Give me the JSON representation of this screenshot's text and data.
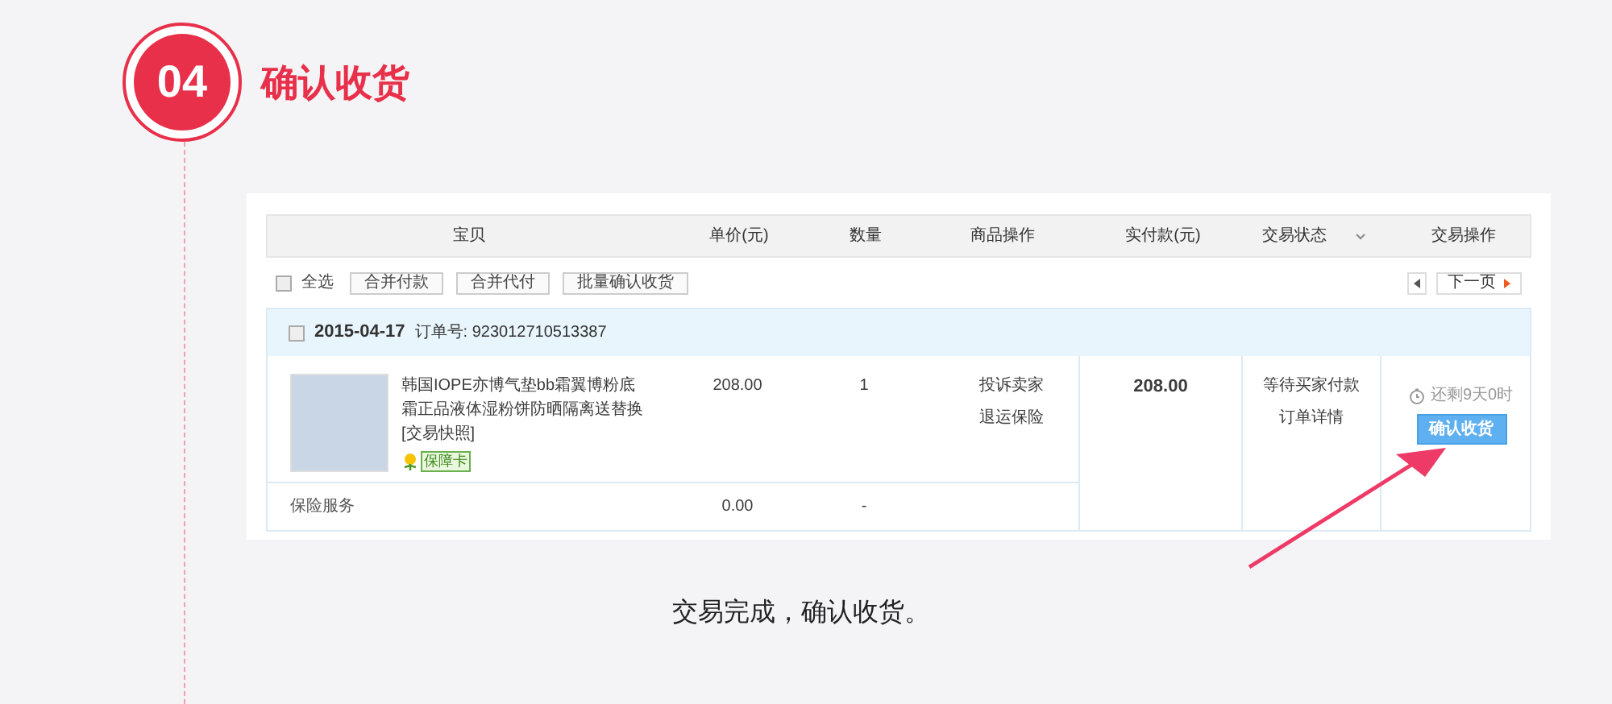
{
  "step": {
    "number": "04",
    "title": "确认收货"
  },
  "table": {
    "columns": [
      "宝贝",
      "单价(元)",
      "数量",
      "商品操作",
      "实付款(元)",
      "交易状态",
      "交易操作"
    ]
  },
  "toolbar": {
    "select_all": {
      "label": "全选",
      "checked": false
    },
    "buttons": [
      "合并付款",
      "合并代付",
      "批量确认收货"
    ],
    "next_page": "下一页"
  },
  "order": {
    "checked": false,
    "date": "2015-04-17",
    "number_label": "订单号:",
    "number": "923012710513387",
    "item": {
      "title": "韩国IOPE亦博气垫bb霜翼博粉底霜正品液体湿粉饼防晒隔离送替换",
      "snapshot": "[交易快照]",
      "badge": "保障卡",
      "price": "208.00",
      "quantity": "1",
      "actions": [
        "投诉卖家",
        "退运保险"
      ]
    },
    "insurance": {
      "label": "保险服务",
      "price": "0.00",
      "quantity": "-"
    },
    "total": "208.00",
    "status_links": [
      "等待买家付款",
      "订单详情"
    ],
    "countdown": "还剩9天0时",
    "confirm_button": "确认收货"
  },
  "caption": "交易完成，确认收货。"
}
